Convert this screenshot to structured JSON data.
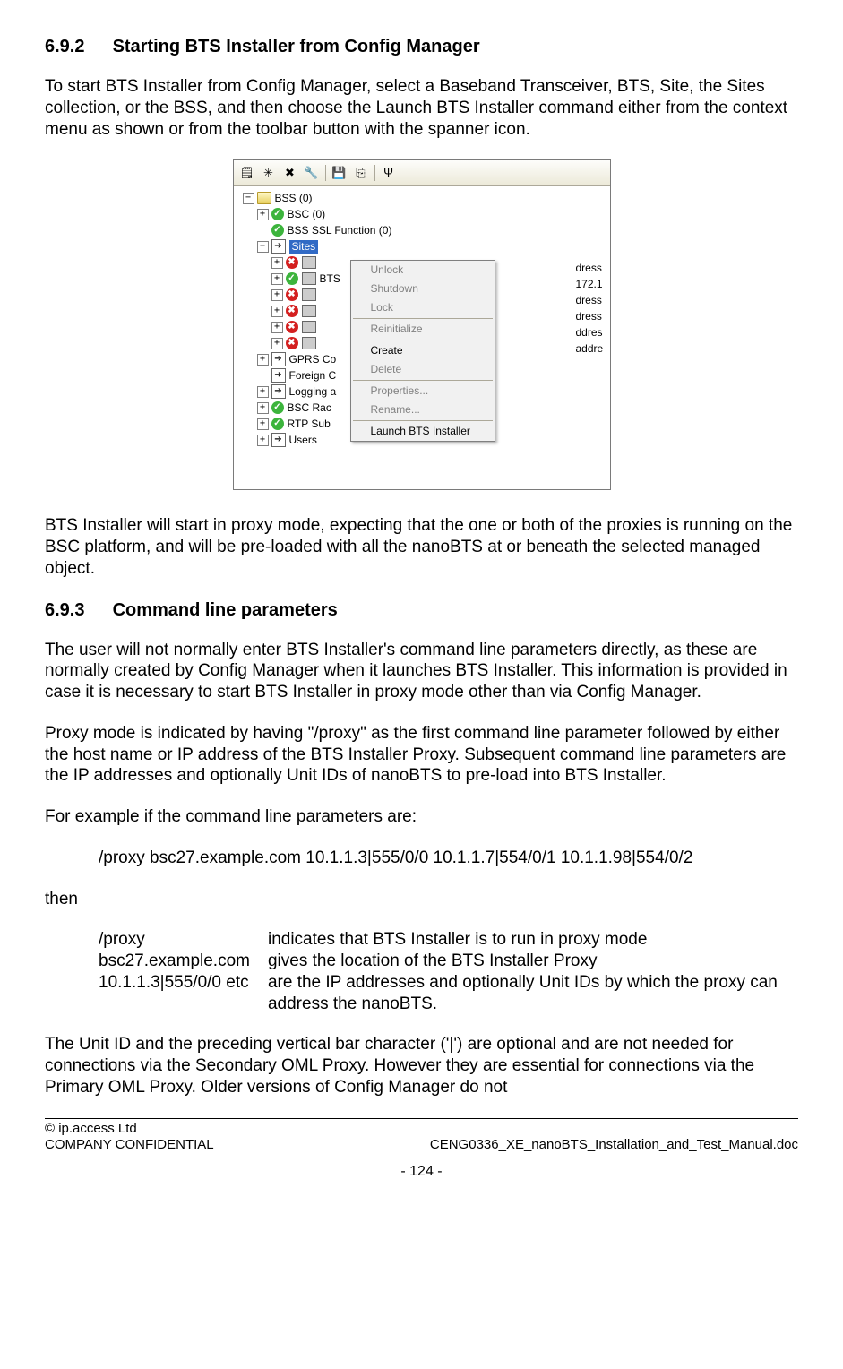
{
  "section1": {
    "num": "6.9.2",
    "title": "Starting BTS Installer from Config Manager",
    "p1": "To start BTS Installer from Config Manager, select a Baseband Transceiver, BTS, Site, the Sites collection, or the BSS, and then choose the Launch BTS Installer command either from the context menu as shown or from the toolbar button with the spanner icon.",
    "p2": "BTS Installer will start in proxy mode, expecting that the one or both of the proxies is running on the BSC platform, and will be pre-loaded with all the nanoBTS at or beneath the selected managed object."
  },
  "section2": {
    "num": "6.9.3",
    "title": "Command line parameters",
    "p1": "The user will not normally enter BTS Installer's command line parameters directly, as these are normally created by Config Manager when it launches BTS Installer. This information is provided in case it is necessary to start BTS Installer in proxy mode other than via Config Manager.",
    "p2": "Proxy mode is indicated by having \"/proxy\" as the first command line parameter followed by either the host name or IP address of the BTS Installer Proxy. Subsequent command line parameters are the IP addresses and optionally Unit IDs of nanoBTS to pre-load into BTS Installer.",
    "p3": "For example if the command line parameters are:",
    "example": "/proxy bsc27.example.com 10.1.1.3|555/0/0 10.1.1.7|554/0/1 10.1.1.98|554/0/2",
    "then": "then",
    "params": [
      {
        "k": "/proxy",
        "d": "indicates that BTS Installer is to run in proxy mode"
      },
      {
        "k": "bsc27.example.com",
        "d": "gives the location of the BTS Installer Proxy"
      },
      {
        "k": "10.1.1.3|555/0/0 etc",
        "d": "are the IP addresses and optionally Unit IDs by which the proxy can address the nanoBTS."
      }
    ],
    "p4": "The Unit ID and the preceding vertical bar character ('|') are optional and are not needed for connections via the Secondary OML Proxy. However they are essential for connections via the Primary OML Proxy. Older versions of Config Manager do not"
  },
  "screenshot": {
    "toolbar_icons": [
      "note-icon",
      "new-icon",
      "delete-icon",
      "wrench-icon",
      "save-icon",
      "copy-icon",
      "filter-icon"
    ],
    "tree": {
      "root": "BSS (0)",
      "bsc": "BSC (0)",
      "ssl": "BSS SSL Function (0)",
      "sites": "Sites",
      "bts_partial": "BTS ",
      "gprs": "GPRS Co",
      "foreign": "Foreign C",
      "logging": "Logging a",
      "bscrac": "BSC Rac",
      "rtp": "RTP Sub",
      "users": "Users"
    },
    "ctx": {
      "unlock": "Unlock",
      "shutdown": "Shutdown",
      "lock": "Lock",
      "reinit": "Reinitialize",
      "create": "Create",
      "delete": "Delete",
      "props": "Properties...",
      "rename": "Rename...",
      "launch": "Launch BTS Installer"
    },
    "right_labels": [
      "dress",
      "172.1",
      "dress",
      "dress",
      "ddres",
      "addre"
    ]
  },
  "footer": {
    "copyright": "© ip.access Ltd",
    "conf": "COMPANY CONFIDENTIAL",
    "doc": "CENG0336_XE_nanoBTS_Installation_and_Test_Manual.doc",
    "page": "- 124 -"
  }
}
